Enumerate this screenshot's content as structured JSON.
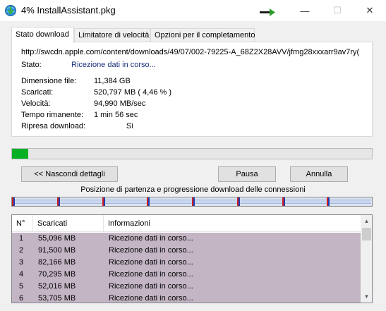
{
  "window": {
    "title": "4% InstallAssistant.pkg",
    "minimize_glyph": "—",
    "maximize_glyph": "☐",
    "close_glyph": "✕"
  },
  "tabs": [
    {
      "label": "Stato download"
    },
    {
      "label": "Limitatore di velocità"
    },
    {
      "label": "Opzioni per il completamento"
    }
  ],
  "details": {
    "url": "http://swcdn.apple.com/content/downloads/49/07/002-79225-A_68Z2X28AVV/jfmg28xxxarr9av7ry(",
    "status_label": "Stato:",
    "status_value": "Ricezione dati in corso...",
    "rows": [
      {
        "label": "Dimensione file:",
        "value": "11,384  GB"
      },
      {
        "label": "Scaricati:",
        "value": "520,797  MB  ( 4,46 % )"
      },
      {
        "label": "Velocità:",
        "value": "94,990  MB/sec"
      },
      {
        "label": "Tempo rimanente:",
        "value": "1 min 56 sec"
      },
      {
        "label": "Ripresa download:",
        "value": "               Sì"
      }
    ]
  },
  "progress": {
    "percent": 4.46,
    "color": "#06b025"
  },
  "buttons": {
    "details": "<< Nascondi dettagli",
    "pause": "Pausa",
    "cancel": "Annulla"
  },
  "connections": {
    "caption": "Posizione di partenza e progressione download delle connessioni",
    "segments": 8,
    "start_color": "#d02020",
    "progress_color": "#2040b0"
  },
  "table": {
    "headers": [
      "N°",
      "Scaricati",
      "Informazioni"
    ],
    "rows": [
      [
        "1",
        "55,096  MB",
        "Ricezione dati in corso..."
      ],
      [
        "2",
        "91,500  MB",
        "Ricezione dati in corso..."
      ],
      [
        "3",
        "82,166  MB",
        "Ricezione dati in corso..."
      ],
      [
        "4",
        "70,295  MB",
        "Ricezione dati in corso..."
      ],
      [
        "5",
        "52,016  MB",
        "Ricezione dati in corso..."
      ],
      [
        "6",
        "53,705  MB",
        "Ricezione dati in corso..."
      ]
    ],
    "row_color": "#c3b5c4"
  }
}
